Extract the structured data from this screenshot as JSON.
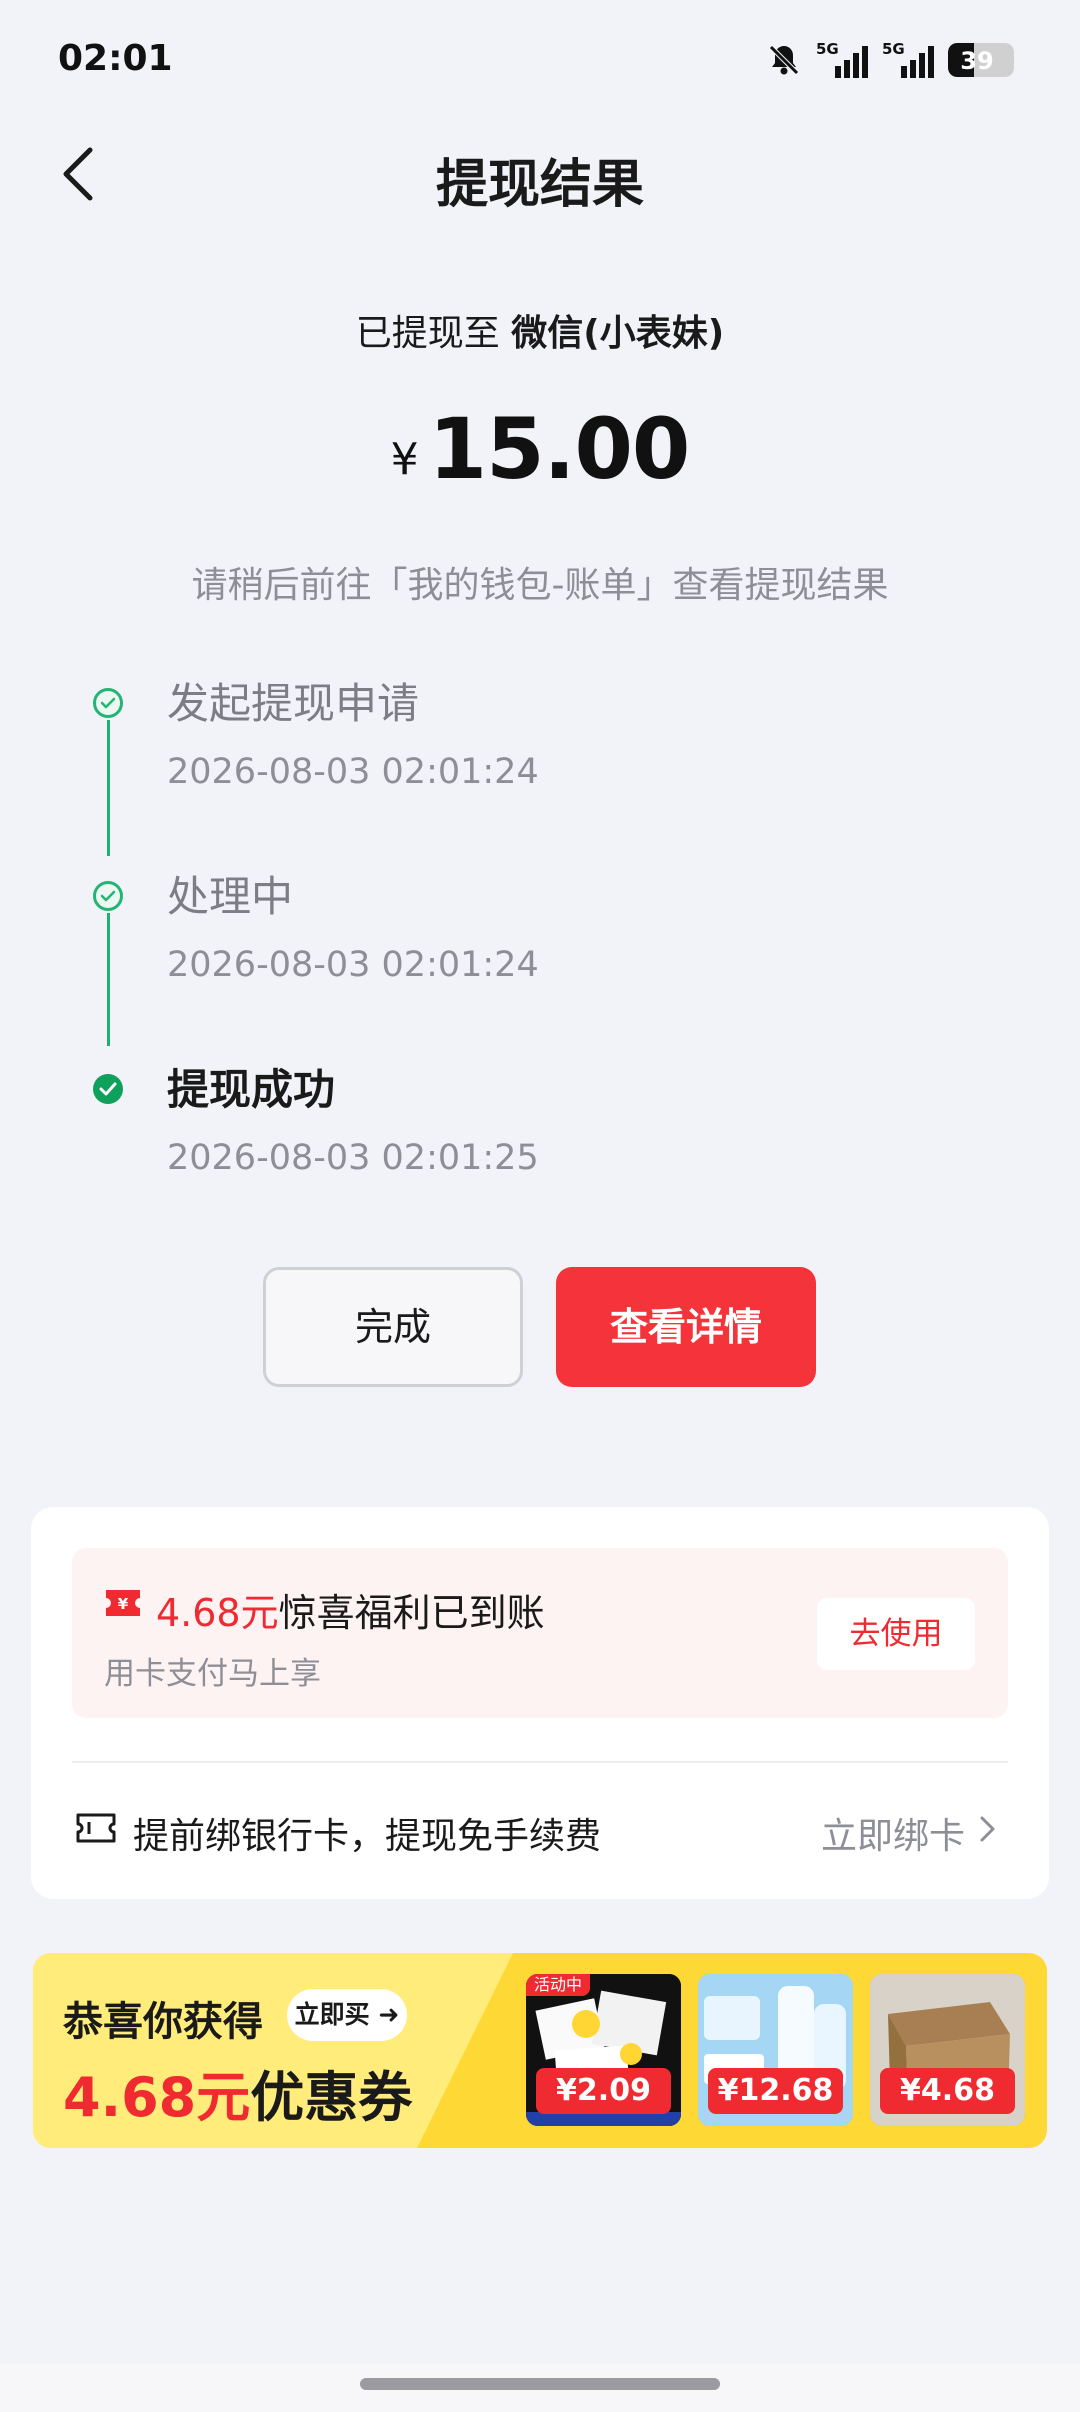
{
  "status_bar": {
    "time": "02:01",
    "network_1": "5G",
    "network_2": "5G",
    "battery": "39",
    "battery_level_percent": 39
  },
  "header": {
    "title": "提现结果"
  },
  "result": {
    "destination_prefix": "已提现至",
    "destination_account": "微信(小表妹)",
    "currency": "¥",
    "amount": "15.00",
    "hint": "请稍后前往「我的钱包-账单」查看提现结果"
  },
  "timeline": [
    {
      "title": "发起提现申请",
      "time": "2026-08-03 02:01:24",
      "state": "done"
    },
    {
      "title": "处理中",
      "time": "2026-08-03 02:01:24",
      "state": "done"
    },
    {
      "title": "提现成功",
      "time": "2026-08-03 02:01:25",
      "state": "current"
    }
  ],
  "actions": {
    "done_label": "完成",
    "detail_label": "查看详情"
  },
  "promo": {
    "amount": "4.68元",
    "title_rest": "惊喜福利已到账",
    "subtitle": "用卡支付马上享",
    "button": "去使用"
  },
  "bank": {
    "text": "提前绑银行卡，提现免手续费",
    "link": "立即绑卡"
  },
  "banner": {
    "line1": "恭喜你获得",
    "cta": "立即买",
    "amount": "4.68元",
    "line2_rest": "优惠券",
    "products": [
      {
        "price": "¥2.09",
        "tag": "活动中"
      },
      {
        "price": "¥12.68"
      },
      {
        "price": "¥4.68"
      }
    ]
  },
  "colors": {
    "accent_red": "#f5333a",
    "success_green": "#0fa05c",
    "background": "#f2f3f8",
    "banner_yellow": "#fed936"
  },
  "icons": [
    "back-arrow-icon",
    "mute-bell-icon",
    "signal-icon",
    "battery-icon",
    "check-circle-icon",
    "ticket-icon",
    "bank-card-icon",
    "chevron-right-icon"
  ]
}
